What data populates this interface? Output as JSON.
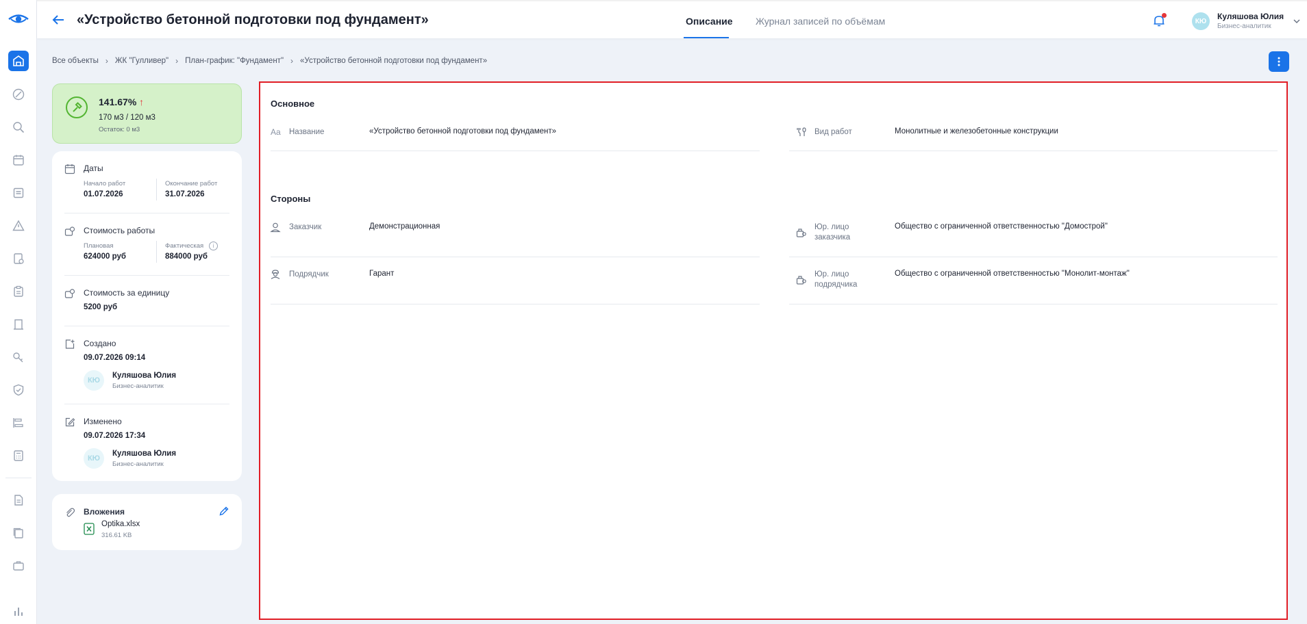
{
  "header": {
    "title": "«Устройство бетонной подготовки под фундамент»",
    "tabs": [
      {
        "label": "Описание",
        "active": true
      },
      {
        "label": "Журнал записей по объёмам",
        "active": false
      }
    ],
    "user": {
      "initials": "КЮ",
      "name": "Куляшова Юлия",
      "role": "Бизнес-аналитик"
    }
  },
  "breadcrumb": [
    "Все объекты",
    "ЖК \"Гулливер\"",
    "План-график: \"Фундамент\"",
    "«Устройство бетонной подготовки под фундамент»"
  ],
  "progress": {
    "percent": "141.67%",
    "trend": "↑",
    "volume": "170 м3 / 120 м3",
    "remainder": "Остаток: 0 м3",
    "color": "#d5f1c9"
  },
  "dates": {
    "title": "Даты",
    "start_label": "Начало работ",
    "start_value": "01.07.2026",
    "end_label": "Окончание работ",
    "end_value": "31.07.2026"
  },
  "cost": {
    "title": "Стоимость работы",
    "planned_label": "Плановая",
    "planned_value": "624000 руб",
    "actual_label": "Фактическая",
    "actual_value": "884000 руб"
  },
  "unit_cost": {
    "title": "Стоимость за единицу",
    "value": "5200 руб"
  },
  "created": {
    "title": "Создано",
    "datetime": "09.07.2026 09:14",
    "person": {
      "initials": "КЮ",
      "name": "Куляшова Юлия",
      "role": "Бизнес-аналитик"
    }
  },
  "modified": {
    "title": "Изменено",
    "datetime": "09.07.2026 17:34",
    "person": {
      "initials": "КЮ",
      "name": "Куляшова Юлия",
      "role": "Бизнес-аналитик"
    }
  },
  "attachments": {
    "title": "Вложения",
    "files": [
      {
        "name": "Optika.xlsx",
        "size": "316.61 KB"
      }
    ]
  },
  "main": {
    "basic": {
      "title": "Основное",
      "name_label": "Название",
      "name_value": "«Устройство бетонной подготовки под фундамент»",
      "work_type_label": "Вид работ",
      "work_type_value": "Монолитные и железобетонные конструкции"
    },
    "parties": {
      "title": "Стороны",
      "customer_label": "Заказчик",
      "customer_value": "Демонстрационная",
      "customer_legal_label": "Юр. лицо заказчика",
      "customer_legal_value": "Общество с ограниченной ответственностью \"Домострой\"",
      "contractor_label": "Подрядчик",
      "contractor_value": "Гарант",
      "contractor_legal_label": "Юр. лицо подрядчика",
      "contractor_legal_value": "Общество с ограниченной ответственностью \"Монолит-монтаж\""
    }
  },
  "colors": {
    "accent": "#1a73e8",
    "highlight_border": "#e11d25",
    "trend_up": "#e5383b"
  }
}
